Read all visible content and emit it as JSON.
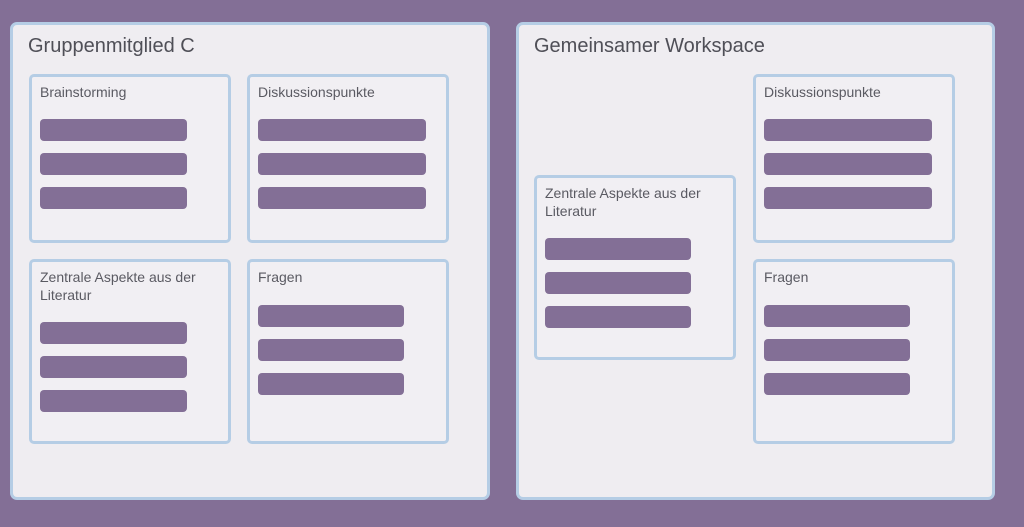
{
  "colors": {
    "background": "#836f96",
    "panel": "#efedf1",
    "border": "#b5cde5",
    "bar": "#836f96"
  },
  "member_panel": {
    "title": "Gruppenmitglied C",
    "cards": {
      "brainstorming": {
        "title": "Brainstorming",
        "items": 3
      },
      "discussion": {
        "title": "Diskussionspunkte",
        "items": 3
      },
      "literature": {
        "title": "Zentrale Aspekte aus der Literatur",
        "items": 3
      },
      "questions": {
        "title": "Fragen",
        "items": 3
      }
    }
  },
  "workspace_panel": {
    "title": "Gemeinsamer Workspace",
    "cards": {
      "literature": {
        "title": "Zentrale Aspekte aus der Literatur",
        "items": 3
      },
      "discussion": {
        "title": "Diskussionspunkte",
        "items": 3
      },
      "questions": {
        "title": "Fragen",
        "items": 3
      }
    }
  }
}
